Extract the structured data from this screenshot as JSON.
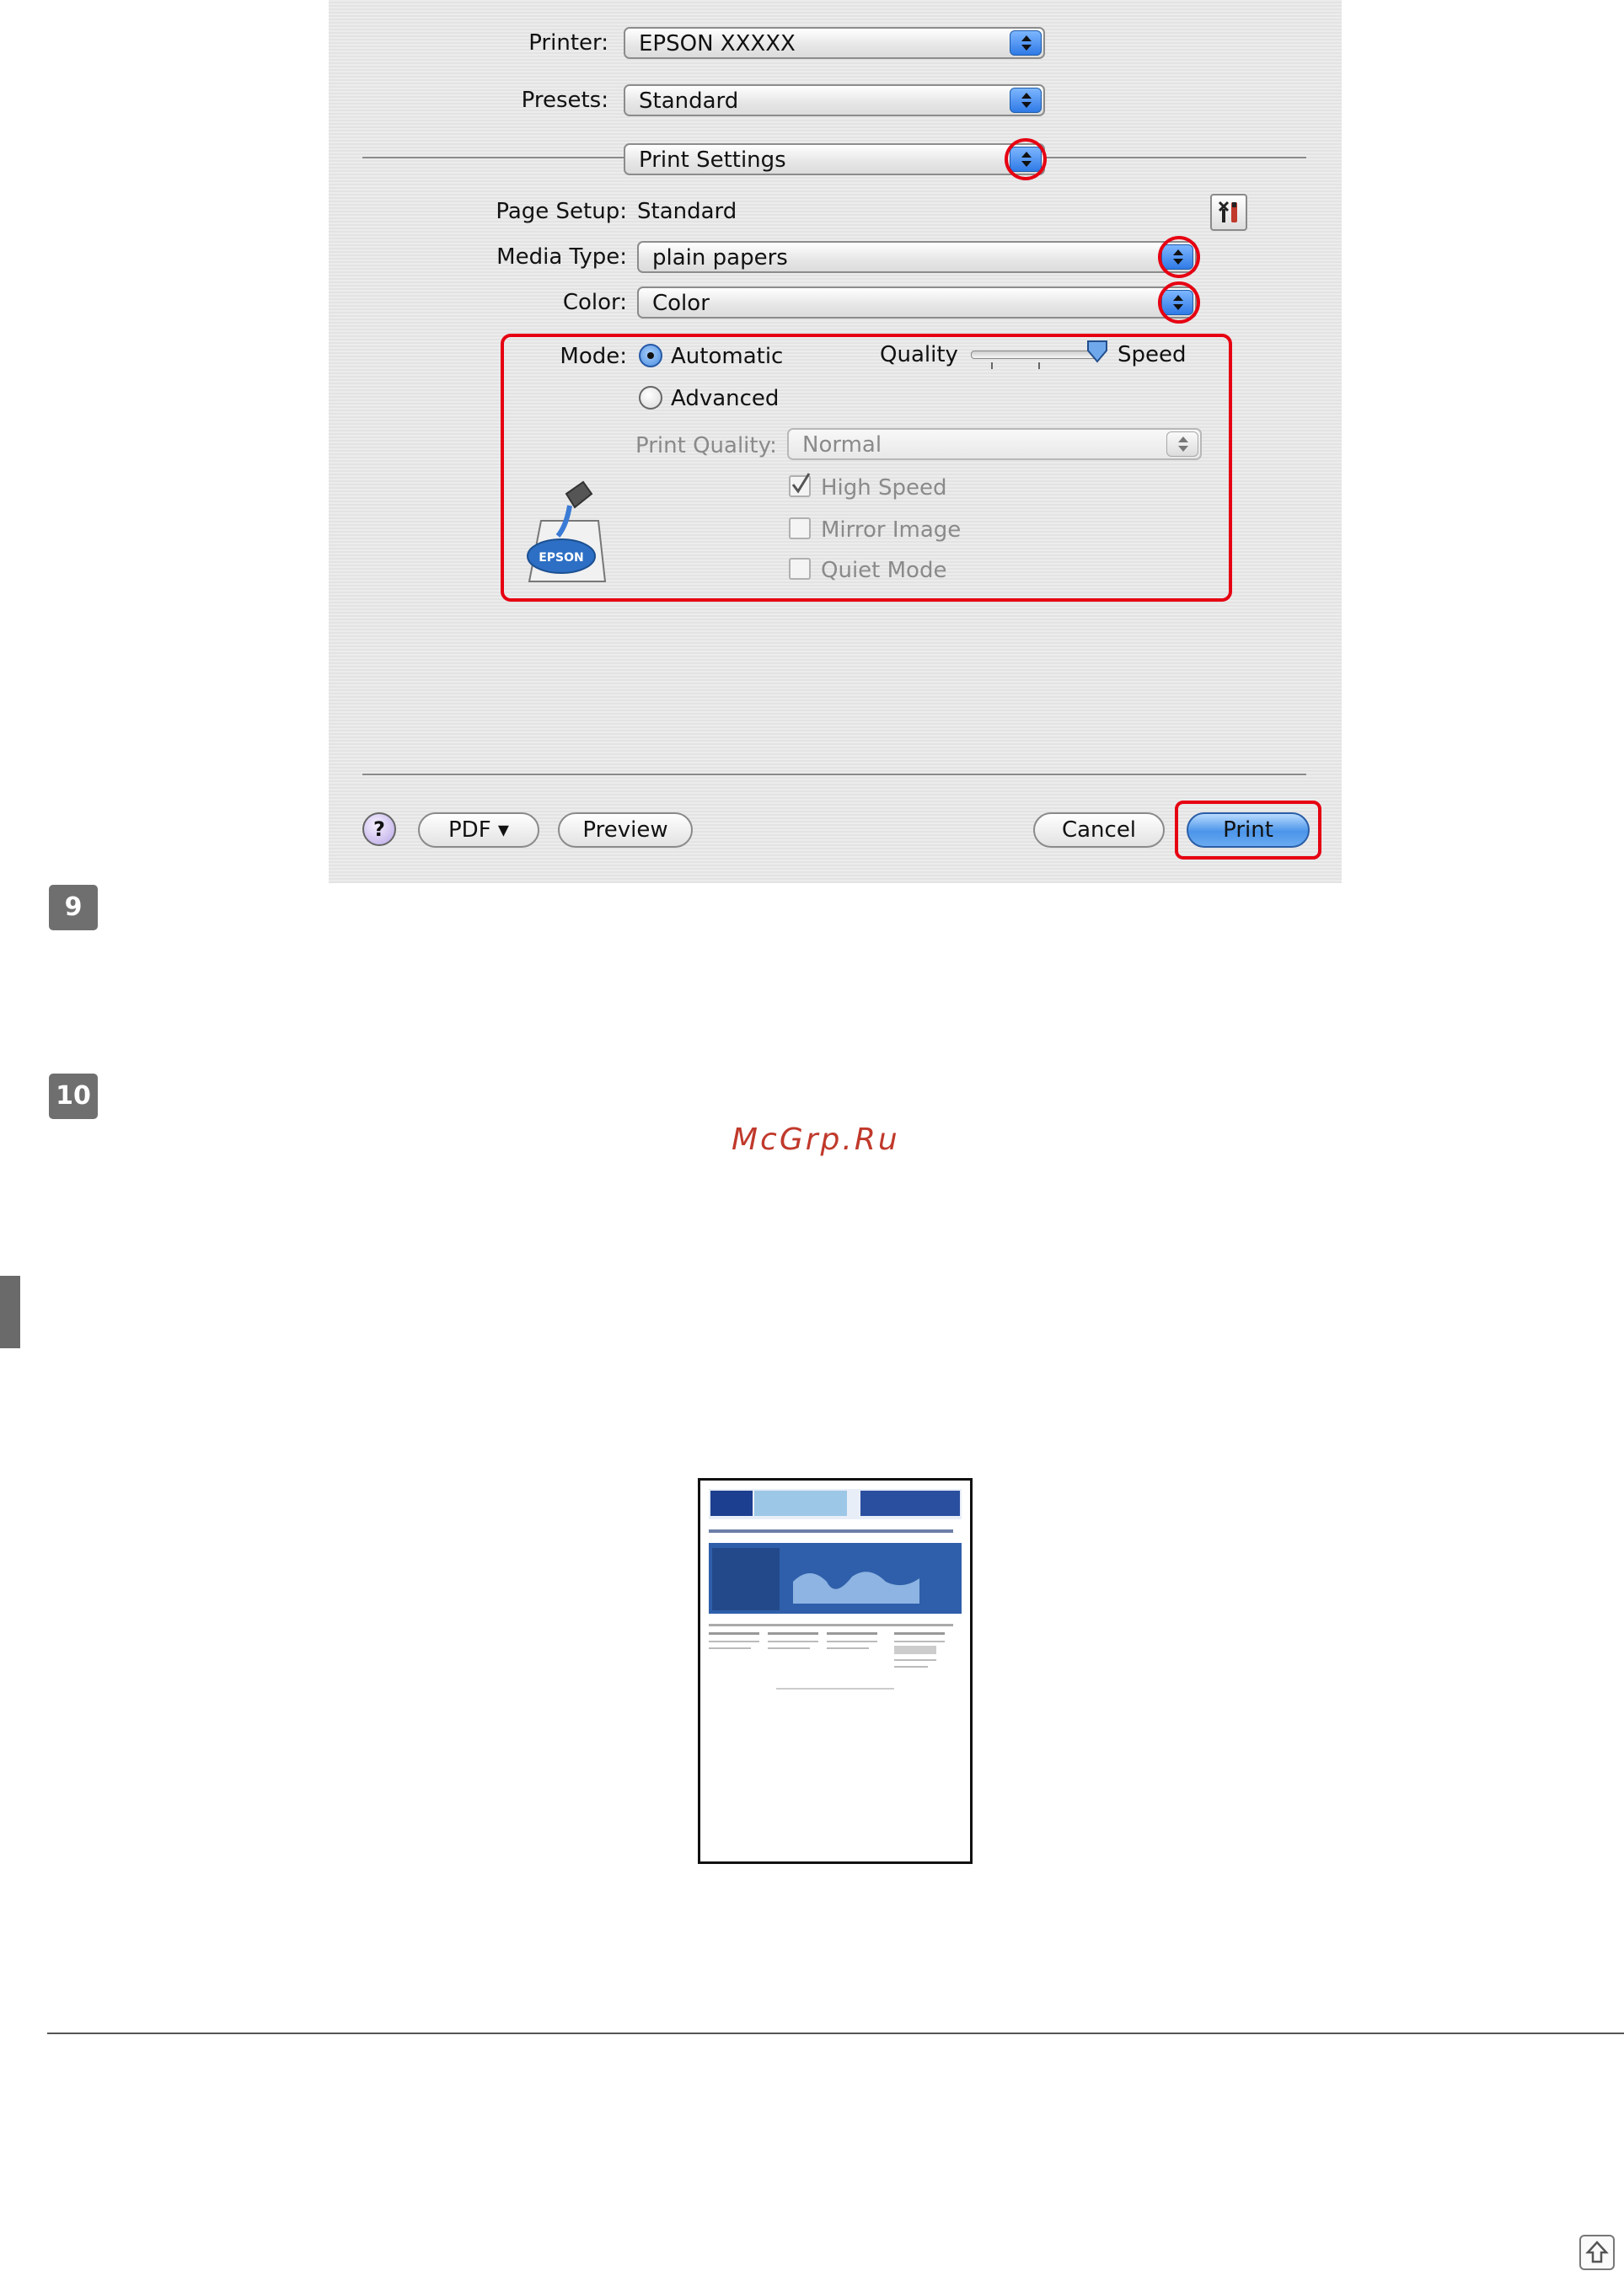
{
  "print_dialog": {
    "printer_label": "Printer:",
    "printer_value": "EPSON XXXXX",
    "presets_label": "Presets:",
    "presets_value": "Standard",
    "panel_value": "Print Settings",
    "page_setup_label": "Page Setup:",
    "page_setup_value": "Standard",
    "media_type_label": "Media Type:",
    "media_type_value": "plain papers",
    "color_label": "Color:",
    "color_value": "Color",
    "mode_label": "Mode:",
    "mode_automatic": "Automatic",
    "mode_advanced": "Advanced",
    "mode_selected": "Automatic",
    "quality_label": "Quality",
    "speed_label": "Speed",
    "slider_level": 1.0,
    "print_quality_label": "Print Quality:",
    "print_quality_value": "Normal",
    "high_speed_label": "High Speed",
    "high_speed_checked": true,
    "mirror_image_label": "Mirror Image",
    "mirror_image_checked": false,
    "quiet_mode_label": "Quiet Mode",
    "quiet_mode_checked": false,
    "help_label": "?",
    "pdf_label": "PDF ▾",
    "preview_label": "Preview",
    "cancel_label": "Cancel",
    "print_label": "Print",
    "epson_logo_text": "EPSON"
  },
  "steps": [
    {
      "number": "9"
    },
    {
      "number": "10"
    }
  ],
  "watermark": "McGrp.Ru",
  "highlight_color": "#e60012",
  "icons": [
    "utility-tools-icon",
    "epson-ink-bottle-icon",
    "scroll-to-top-icon"
  ]
}
